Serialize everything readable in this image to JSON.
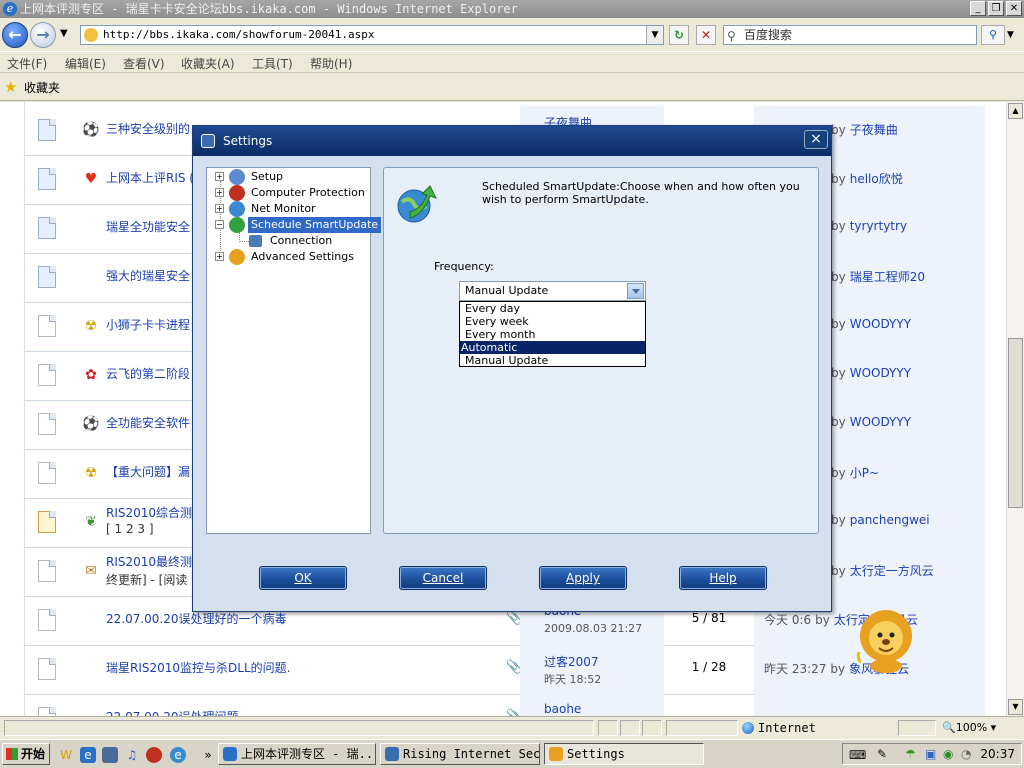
{
  "browser": {
    "window_title": "上网本评测专区 - 瑞星卡卡安全论坛bbs.ikaka.com - Windows Internet Explorer",
    "address": "http://bbs.ikaka.com/showforum-20041.aspx",
    "search_placeholder": "百度搜索",
    "menu": [
      "文件(F)",
      "编辑(E)",
      "查看(V)",
      "收藏夹(A)",
      "工具(T)",
      "帮助(H)"
    ],
    "favorites_label": "收藏夹",
    "status_zone": "Internet",
    "zoom": "100%"
  },
  "forum": {
    "rows": [
      {
        "icon": "soccer",
        "title": "三种安全级别的",
        "author": "子夜舞曲",
        "author_date": "",
        "replies": "",
        "last": "",
        "last_by": "子夜舞曲",
        "doc": "blue"
      },
      {
        "icon": "heart",
        "title": "上网本上评RIS (",
        "author": "",
        "author_date": "",
        "replies": "",
        "last": "",
        "last_by": "hello欣悦",
        "doc": "blue"
      },
      {
        "icon": "",
        "title": "瑞星全功能安全",
        "author": "",
        "author_date": "",
        "replies": "",
        "last": "",
        "last_by": "tyryrtytry",
        "doc": "blue"
      },
      {
        "icon": "",
        "title": "强大的瑞星安全",
        "author": "",
        "author_date": "",
        "replies": "",
        "last": "",
        "last_by": "瑞星工程师20",
        "doc": "blue"
      },
      {
        "icon": "radiation",
        "title": "小狮子卡卡进程",
        "author": "",
        "author_date": "",
        "replies": "",
        "last": "",
        "last_by": "WOODYYY",
        "doc": "grey"
      },
      {
        "icon": "rose",
        "title": "云飞的第二阶段",
        "author": "",
        "author_date": "",
        "replies": "",
        "last": "",
        "last_by": "WOODYYY",
        "doc": "grey"
      },
      {
        "icon": "soccer",
        "title": "全功能安全软件",
        "author": "",
        "author_date": "",
        "replies": "",
        "last": "",
        "last_by": "WOODYYY",
        "doc": "grey"
      },
      {
        "icon": "radiation",
        "title": "【重大问题】漏",
        "author": "",
        "author_date": "",
        "replies": "",
        "last": "",
        "last_by": "小P~",
        "doc": "grey"
      },
      {
        "icon": "leaf",
        "title": "RIS2010综合测试",
        "title2": "[ 1 2 3 ]",
        "author": "",
        "author_date": "",
        "replies": "",
        "last": "",
        "last_by": "panchengwei",
        "doc": "home"
      },
      {
        "icon": "scroll",
        "title": "RIS2010最终测试",
        "title2": "终更新] - [阅读",
        "author": "",
        "author_date": "",
        "replies": "",
        "last": "",
        "last_by": "太行定一方风云",
        "doc": "grey"
      },
      {
        "icon": "",
        "title": "22.07.00.20误处理好的一个病毒",
        "author": "baohe",
        "author_date": "2009.08.03 21:27",
        "replies": "5 / 81",
        "last": "今天 0:6",
        "last_by": "太行定一方风云",
        "doc": "grey",
        "clip": true
      },
      {
        "icon": "",
        "title": "瑞星RIS2010监控与杀DLL的问题.",
        "author": "过客2007",
        "author_date": "昨天 18:52",
        "replies": "1 / 28",
        "last": "昨天 23:27",
        "last_by": "象风暴狂云",
        "doc": "grey",
        "clip": true
      },
      {
        "icon": "",
        "title": "22.07.00.20误处理问题",
        "author": "baohe",
        "author_date": "",
        "replies": "",
        "last": "",
        "last_by": "",
        "doc": "grey",
        "clip": true
      }
    ],
    "by_word": "by"
  },
  "dialog": {
    "title": "Settings",
    "tree": [
      {
        "label": "Setup",
        "expander": "+"
      },
      {
        "label": "Computer Protection",
        "expander": "+"
      },
      {
        "label": "Net Monitor",
        "expander": "+"
      },
      {
        "label": "Schedule SmartUpdate",
        "expander": "−",
        "selected": true
      },
      {
        "label": "Connection",
        "expander": ""
      },
      {
        "label": "Advanced Settings",
        "expander": "+"
      }
    ],
    "description": "Scheduled SmartUpdate:Choose when and how often you wish to perform SmartUpdate.",
    "frequency_label": "Frequency:",
    "frequency_value": "Manual Update",
    "frequency_options": [
      "Every day",
      "Every week",
      "Every month",
      "Automatic",
      "Manual Update"
    ],
    "highlighted_option": "Automatic",
    "buttons": {
      "ok": "OK",
      "cancel": "Cancel",
      "apply": "Apply",
      "help": "Help"
    }
  },
  "taskbar": {
    "start": "开始",
    "tasks": [
      {
        "label": "上网本评测专区 - 瑞...",
        "active": false
      },
      {
        "label": "Rising Internet Sec...",
        "active": false
      },
      {
        "label": "Settings",
        "active": true
      }
    ],
    "clock": "20:37"
  },
  "colors": {
    "dialog_title": "#0b2c66",
    "dialog_button": "#1a4c98",
    "highlight": "#0a246a",
    "link": "#1a3eb0"
  }
}
